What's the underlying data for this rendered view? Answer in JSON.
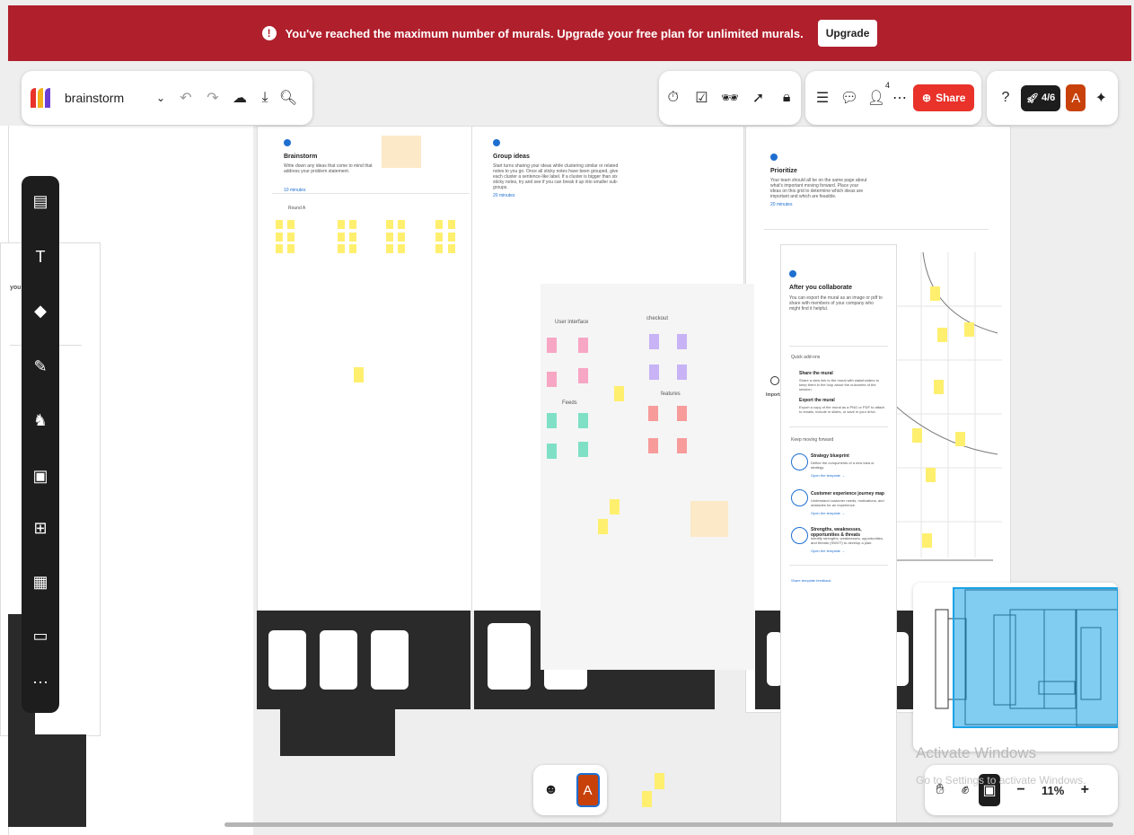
{
  "banner": {
    "message": "You've reached the maximum number of murals. Upgrade your free plan for unlimited murals.",
    "upgrade_label": "Upgrade",
    "color": "#b01f2c"
  },
  "header": {
    "board_name": "brainstorm",
    "collaborator_count": "4",
    "share_label": "Share",
    "progress_label": "4/6",
    "avatar_letter": "A",
    "icons": [
      "logo-icon",
      "chevron-down-icon",
      "undo-icon",
      "redo-icon",
      "cloud-icon",
      "download-icon",
      "search-icon",
      "timer-icon",
      "checkbox-icon",
      "private-mode-icon",
      "cursor-icon",
      "lock-icon",
      "outline-icon",
      "comment-icon",
      "people-icon",
      "more-icon",
      "share-icon",
      "help-icon",
      "rocket-icon",
      "sparkle-icon"
    ]
  },
  "canvas": {
    "brainstorm": {
      "title": "Brainstorm",
      "desc": "Write down any ideas that come to mind that address your problem statement.",
      "time": "10 minutes",
      "round": "Round A"
    },
    "group": {
      "title": "Group ideas",
      "desc": "Start turns sharing your ideas while clustering similar or related notes to you go. Once all sticky notes have been grouped, give each cluster a sentence-like label. If a cluster is bigger than six sticky notes, try and see if you can break it up into smaller sub-groups.",
      "time": "20 minutes"
    },
    "prioritize": {
      "title": "Prioritize",
      "desc": "Your team should all be on the same page about what's important moving forward. Place your ideas on this grid to determine which ideas are important and which are feasible.",
      "time": "20 minutes"
    },
    "cluster": {
      "label_ui": "User interface",
      "label_checkout": "checkout",
      "label_feed": "Feeds",
      "label_features": "features"
    },
    "after": {
      "title": "After you collaborate",
      "desc": "You can export the mural as an image or pdf to share with members of your company who might find it helpful.",
      "quick_links": "Quick add-ons",
      "link1_title": "Share the mural",
      "link1_desc": "Share a view link to the mural with stakeholders to keep them in the loop about the outcomes of the session.",
      "link2_title": "Export the mural",
      "link2_desc": "Export a copy of the mural as a PNG or PDF to attach to emails, include in slides, or save in your drive.",
      "keep": "Keep moving forward",
      "t1_title": "Strategy blueprint",
      "t1_desc": "Define the components of a new idea or strategy.",
      "t2_title": "Customer experience journey map",
      "t2_desc": "Understand customer needs, motivations, and obstacles for an experience.",
      "t3_title": "Strengths, weaknesses, opportunities & threats",
      "t3_desc": "Identify strengths, weaknesses, opportunities, and threats (SWOT) to develop a plan.",
      "open_template": "Open the template →",
      "feedback": "Share template feedback"
    },
    "importance": "Importance"
  },
  "bottom": {
    "avatar_letter": "A",
    "zoom": "11%",
    "zoom_out": "−",
    "zoom_in": "+"
  },
  "watermark": {
    "line1": "Activate Windows",
    "line2": "Go to Settings to activate Windows."
  }
}
